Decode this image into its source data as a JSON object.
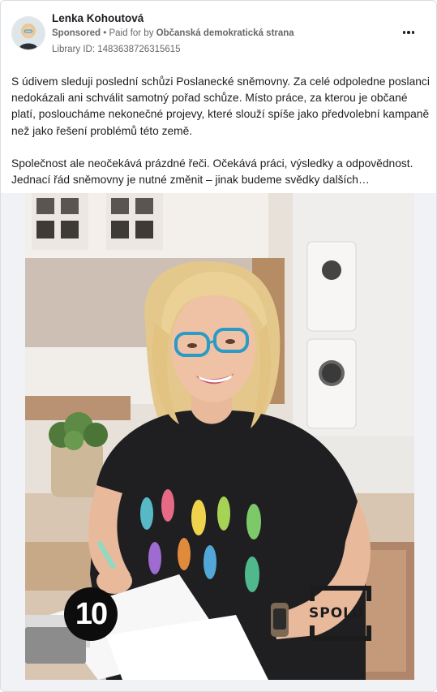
{
  "ad": {
    "author_name": "Lenka Kohoutová",
    "sponsored_label": "Sponsored",
    "paid_for_prefix": " • Paid for by ",
    "payer": "Občanská demokratická strana",
    "library_id": "Library ID: 1483638726315615",
    "paragraph_1": "S údivem sleduji poslední schůzi Poslanecké sněmovny. Za celé odpoledne poslanci nedokázali ani schválit samotný pořad schůze. Místo práce, za kterou je občané platí, posloucháme nekonečné projevy, které slouží spíše jako předvolební kampaně než jako řešení problémů této země.",
    "paragraph_2": "Společnost ale neočekává prázdné řeči. Očekává práci, výsledky a odpovědnost. Jednací řád sněmovny je nutné změnit – jinak budeme svědky dalších…",
    "image": {
      "badge_number": "10",
      "logo_text": "SPOLU"
    }
  },
  "icons": {
    "more": "more-dots-icon",
    "avatar": "profile-photo"
  },
  "colors": {
    "text_primary": "#1c1e21",
    "text_secondary": "#65676b",
    "border": "#dadde1",
    "badge_bg": "#0d0d0d"
  }
}
